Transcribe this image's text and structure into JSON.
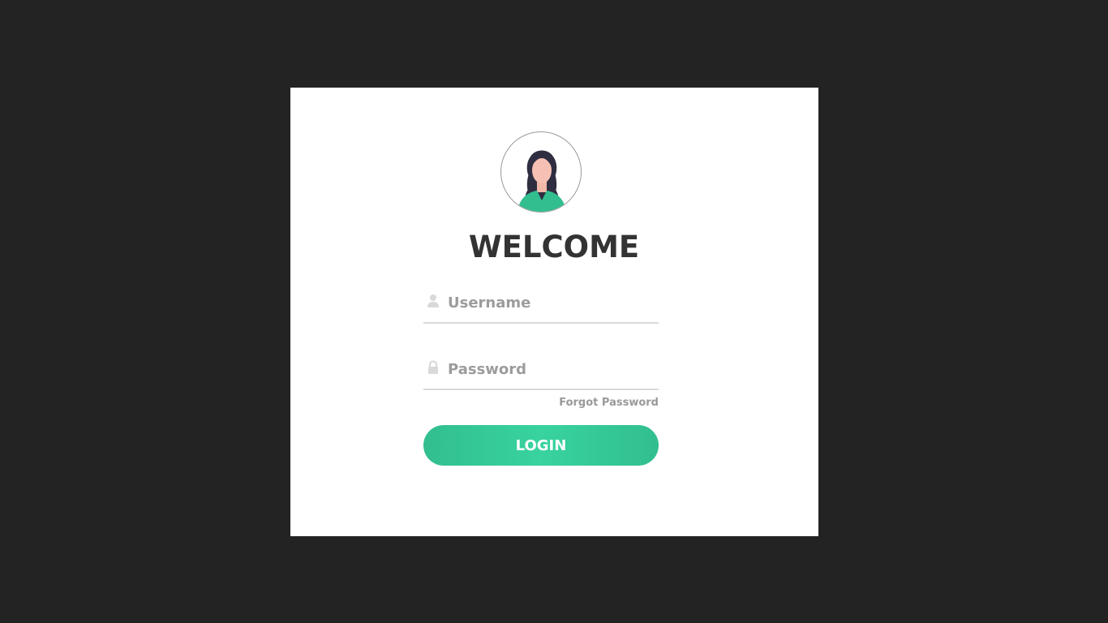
{
  "login": {
    "title": "WELCOME",
    "username_placeholder": "Username",
    "password_placeholder": "Password",
    "forgot_label": "Forgot Password",
    "login_label": "LOGIN"
  },
  "icons": {
    "username": "user-icon",
    "password": "lock-icon"
  },
  "colors": {
    "background": "#232323",
    "card": "#ffffff",
    "accent": "#38d39f",
    "accent_dark": "#32be8f",
    "title_text": "#333333",
    "muted_text": "#999999"
  }
}
